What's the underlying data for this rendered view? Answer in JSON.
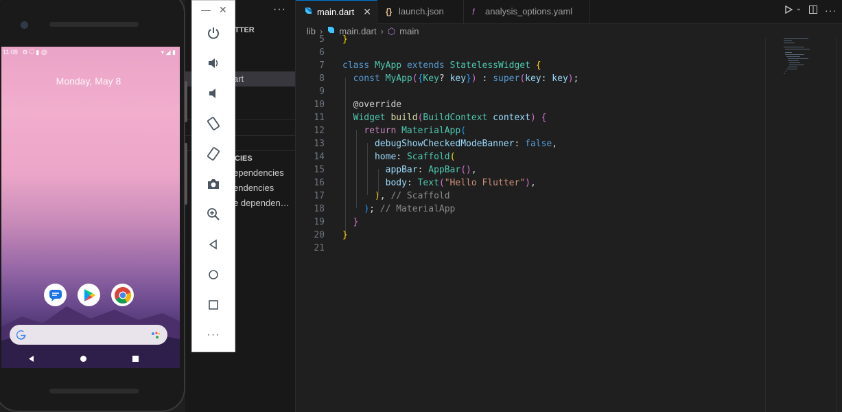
{
  "explorer": {
    "more": "···",
    "section_flutter": "TTER",
    "selected_item": "art",
    "section_deps": "CIES",
    "dep_items": [
      "ependencies",
      "endencies",
      "e dependen…"
    ]
  },
  "tabs": [
    {
      "label": "main.dart",
      "icon": "dart-icon",
      "active": true
    },
    {
      "label": "launch.json",
      "icon": "json-braces-icon",
      "active": false
    },
    {
      "label": "analysis_options.yaml",
      "icon": "exclamation-icon",
      "active": false
    }
  ],
  "breadcrumb": {
    "lib": "lib",
    "file": "main.dart",
    "symbol": "main"
  },
  "editor": {
    "line_numbers": [
      "5",
      "6",
      "7",
      "8",
      "9",
      "10",
      "11",
      "12",
      "13",
      "14",
      "15",
      "16",
      "17",
      "18",
      "19",
      "20",
      "21"
    ],
    "comment_scaffold": "// Scaffold",
    "comment_materialapp": "// MaterialApp",
    "string_hello": "\"Hello Flutter\""
  },
  "phone": {
    "time": "11:08",
    "date": "Monday, May 8",
    "colors": {
      "wallpaper_top": "#f2aecd",
      "wallpaper_bottom": "#2a1d47"
    }
  },
  "emulator_toolbar": {
    "buttons": [
      "power-icon",
      "volume-up-icon",
      "volume-down-icon",
      "rotate-left-icon",
      "rotate-right-icon",
      "camera-icon",
      "zoom-icon",
      "back-icon",
      "home-icon",
      "overview-icon",
      "more-icon"
    ],
    "more_label": "···"
  },
  "colors": {
    "accent": "#0078d4",
    "editor_bg": "#1f1f1f"
  }
}
